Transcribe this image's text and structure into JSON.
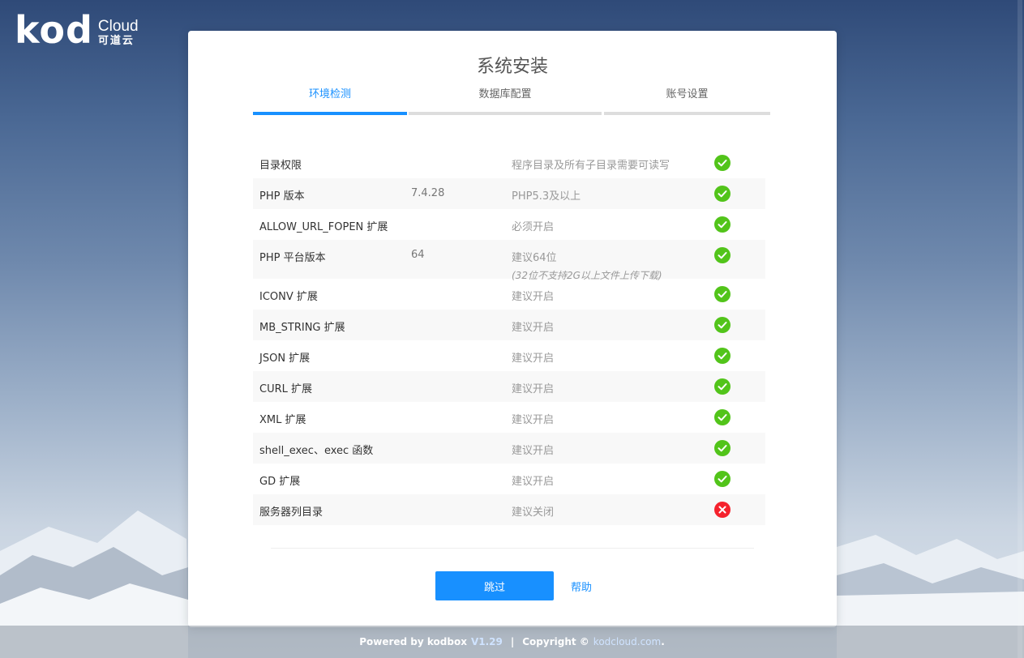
{
  "brand": {
    "kod": "kod",
    "cloud": "Cloud",
    "cn": "可道云"
  },
  "page": {
    "title": "系统安装"
  },
  "steps": [
    {
      "label": "环境检测",
      "active": true
    },
    {
      "label": "数据库配置",
      "active": false
    },
    {
      "label": "账号设置",
      "active": false
    }
  ],
  "checks": [
    {
      "name": "目录权限",
      "value": "",
      "requirement": "程序目录及所有子目录需要可读写",
      "note": "",
      "status": "ok"
    },
    {
      "name": "PHP 版本",
      "value": "7.4.28",
      "requirement": "PHP5.3及以上",
      "note": "",
      "status": "ok"
    },
    {
      "name": "ALLOW_URL_FOPEN 扩展",
      "value": "",
      "requirement": "必须开启",
      "note": "",
      "status": "ok"
    },
    {
      "name": "PHP 平台版本",
      "value": "64",
      "requirement": "建议64位",
      "note": "(32位不支持2G以上文件上传下载)",
      "status": "ok"
    },
    {
      "name": "ICONV 扩展",
      "value": "",
      "requirement": "建议开启",
      "note": "",
      "status": "ok"
    },
    {
      "name": "MB_STRING 扩展",
      "value": "",
      "requirement": "建议开启",
      "note": "",
      "status": "ok"
    },
    {
      "name": "JSON 扩展",
      "value": "",
      "requirement": "建议开启",
      "note": "",
      "status": "ok"
    },
    {
      "name": "CURL 扩展",
      "value": "",
      "requirement": "建议开启",
      "note": "",
      "status": "ok"
    },
    {
      "name": "XML 扩展",
      "value": "",
      "requirement": "建议开启",
      "note": "",
      "status": "ok"
    },
    {
      "name": "shell_exec、exec 函数",
      "value": "",
      "requirement": "建议开启",
      "note": "",
      "status": "ok"
    },
    {
      "name": "GD 扩展",
      "value": "",
      "requirement": "建议开启",
      "note": "",
      "status": "ok"
    },
    {
      "name": "服务器列目录",
      "value": "",
      "requirement": "建议关闭",
      "note": "",
      "status": "error"
    }
  ],
  "actions": {
    "skip_label": "跳过",
    "help_label": "帮助"
  },
  "footer": {
    "powered": "Powered by kodbox",
    "version": "V1.29",
    "separator": "|",
    "copyright": "Copyright ©",
    "domain": "kodcloud.com",
    "suffix": "."
  },
  "colors": {
    "accent": "#1890ff",
    "ok": "#52c41a",
    "error": "#f5222d"
  },
  "icons": {
    "ok": "check-circle-icon",
    "error": "close-circle-icon"
  }
}
